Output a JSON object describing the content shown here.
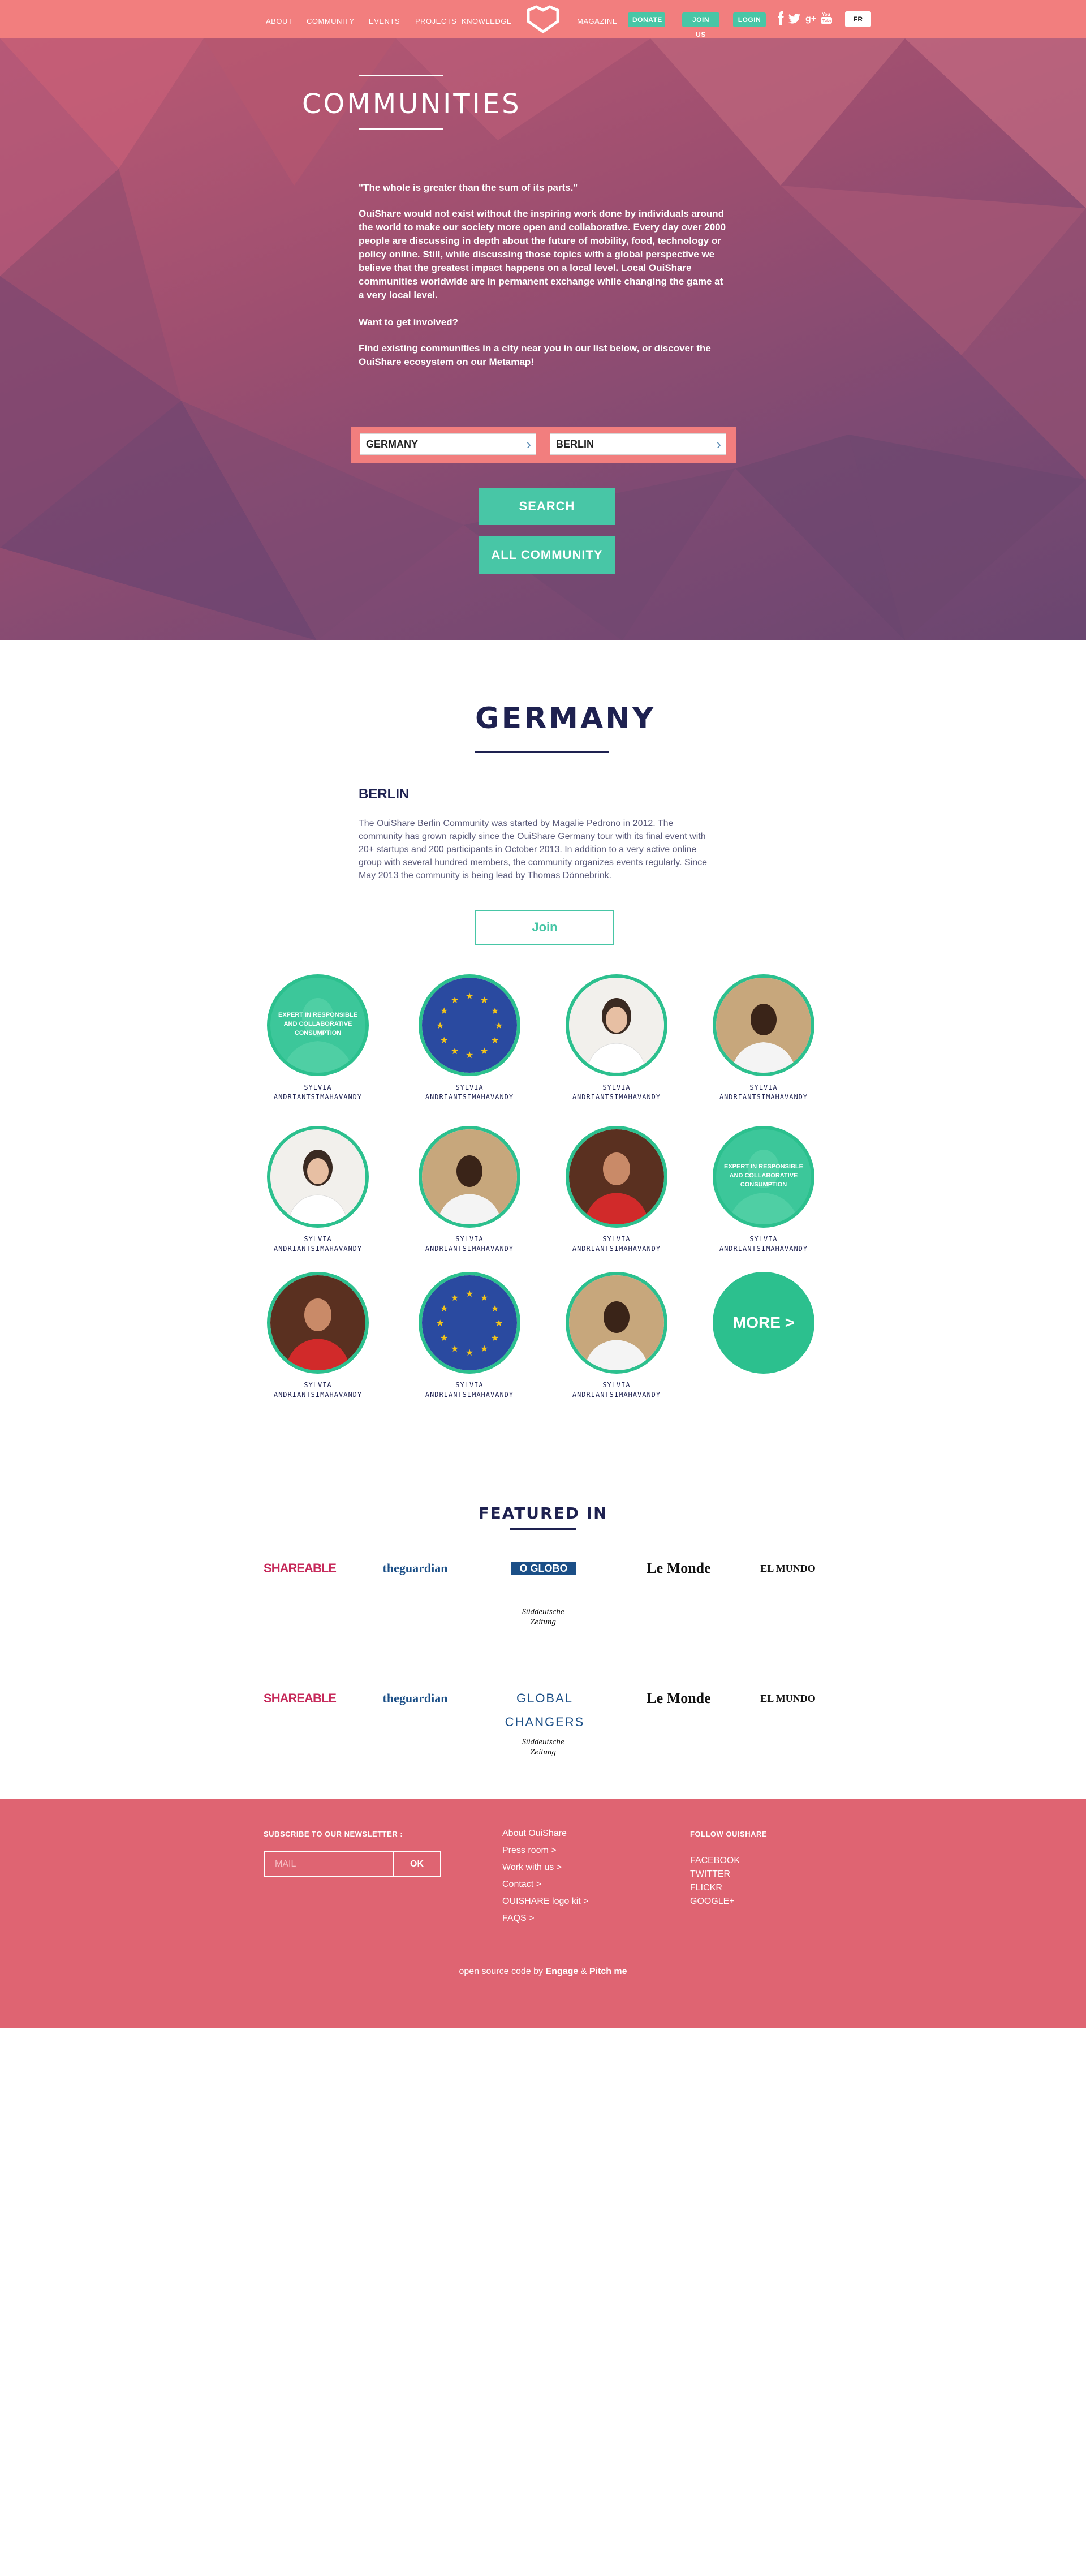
{
  "nav": {
    "items": [
      "ABOUT",
      "COMMUNITY",
      "EVENTS",
      "PROJECTS",
      "KNOWLEDGE",
      "MAGAZINE"
    ],
    "donate": "DONATE",
    "join": "JOIN US",
    "login": "LOGIN",
    "lang": "FR",
    "social_icons": [
      "facebook-icon",
      "twitter-icon",
      "google-plus-icon",
      "youtube-icon"
    ]
  },
  "hero": {
    "title": "COMMUNITIES",
    "quote": "\"The whole is greater than the sum of its parts.\"",
    "paragraph": "OuiShare would not exist without the inspiring work done by individuals around the world to make our society more open and collaborative. Every day over 2000 people are discussing in depth about the future of mobility, food, technology or policy online. Still, while discussing those topics with a global perspective we believe that the greatest impact happens on a local level. Local OuiShare communities worldwide are in permanent exchange while changing the game at a very local level.",
    "question": "Want to get involved?",
    "cta": "Find existing communities in a city near you in our list below, or discover the OuiShare ecosystem on our Metamap!",
    "country_value": "GERMANY",
    "city_value": "BERLIN",
    "search_label": "SEARCH",
    "all_label": "ALL COMMUNITY"
  },
  "community": {
    "country": "GERMANY",
    "city": "BERLIN",
    "description": "The OuiShare Berlin Community was started by Magalie Pedrono in 2012. The community has grown rapidly since the OuiShare Germany tour with its final event with 20+ startups and 200 participants in October 2013. In addition to a very active online group with several hundred members, the community organizes events regularly. Since May 2013 the community is being lead by Thomas Dönnebrink.",
    "join_label": "Join",
    "members": [
      {
        "first": "SYLVIA",
        "last": "ANDRIANTSIMAHAVANDY",
        "type": "expert",
        "badge": "EXPERT IN RESPONSIBLE AND COLLABORATIVE CONSUMPTION"
      },
      {
        "first": "SYLVIA",
        "last": "ANDRIANTSIMAHAVANDY",
        "type": "eu"
      },
      {
        "first": "SYLVIA",
        "last": "ANDRIANTSIMAHAVANDY",
        "type": "woman"
      },
      {
        "first": "SYLVIA",
        "last": "ANDRIANTSIMAHAVANDY",
        "type": "man-dark"
      },
      {
        "first": "SYLVIA",
        "last": "ANDRIANTSIMAHAVANDY",
        "type": "woman"
      },
      {
        "first": "SYLVIA",
        "last": "ANDRIANTSIMAHAVANDY",
        "type": "man-dark"
      },
      {
        "first": "SYLVIA",
        "last": "ANDRIANTSIMAHAVANDY",
        "type": "man-red"
      },
      {
        "first": "SYLVIA",
        "last": "ANDRIANTSIMAHAVANDY",
        "type": "expert",
        "badge": "EXPERT IN RESPONSIBLE AND COLLABORATIVE CONSUMPTION"
      },
      {
        "first": "SYLVIA",
        "last": "ANDRIANTSIMAHAVANDY",
        "type": "man-red"
      },
      {
        "first": "SYLVIA",
        "last": "ANDRIANTSIMAHAVANDY",
        "type": "eu"
      },
      {
        "first": "SYLVIA",
        "last": "ANDRIANTSIMAHAVANDY",
        "type": "man-dark"
      }
    ],
    "more_label": "MORE >"
  },
  "featured": {
    "title": "FEATURED IN",
    "row1": [
      "Shareable",
      "theguardian",
      "O GLOBO",
      "Le Monde",
      "EL MUNDO",
      "Süddeutsche Zeitung"
    ],
    "row2": [
      "Shareable",
      "theguardian",
      "GLOBAL CHANGERS",
      "Le Monde",
      "EL MUNDO",
      "Süddeutsche Zeitung"
    ]
  },
  "footer": {
    "newsletter_title": "SUBSCRIBE TO OUR NEWSLETTER :",
    "mail_placeholder": "MAIL",
    "ok_label": "OK",
    "links": [
      "About OuiShare",
      "Press room >",
      "Work with us >",
      "Contact >",
      "OUISHARE logo kit >",
      "FAQS >"
    ],
    "follow_title": "FOLLOW OUISHARE",
    "follow": [
      "FACEBOOK",
      "TWITTER",
      "FLICKR",
      "GOOGLE+"
    ],
    "credits_prefix": "open source code by",
    "credits_a": "Engage",
    "credits_amp": "&",
    "credits_b": "Pitch me"
  },
  "colors": {
    "nav": "#f27e7e",
    "accent": "#48c6a6",
    "green_ring": "#2cc08e",
    "navy": "#1e2150",
    "footer": "#df6472"
  }
}
